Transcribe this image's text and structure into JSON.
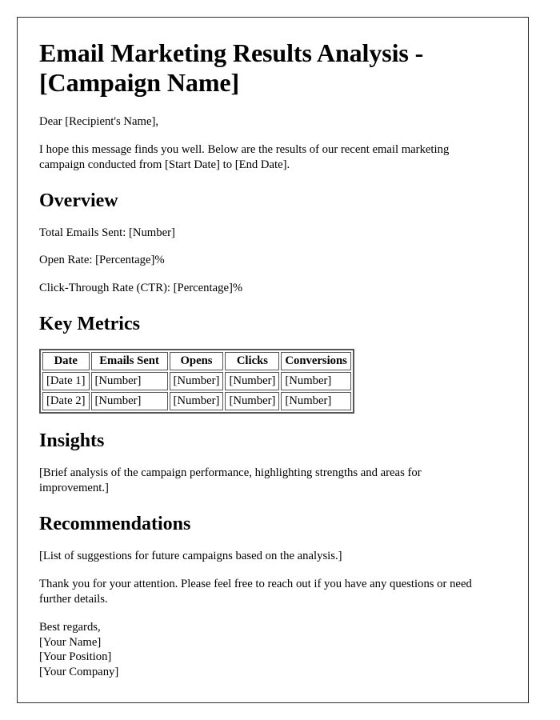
{
  "document": {
    "title": "Email Marketing Results Analysis - [Campaign Name]",
    "salutation": "Dear [Recipient's Name],",
    "intro": "I hope this message finds you well. Below are the results of our recent email marketing campaign conducted from [Start Date] to [End Date].",
    "sections": {
      "overview": {
        "heading": "Overview",
        "lines": [
          "Total Emails Sent: [Number]",
          "Open Rate: [Percentage]%",
          "Click-Through Rate (CTR): [Percentage]%"
        ]
      },
      "key_metrics": {
        "heading": "Key Metrics",
        "columns": [
          "Date",
          "Emails Sent",
          "Opens",
          "Clicks",
          "Conversions"
        ],
        "rows": [
          [
            "[Date 1]",
            "[Number]",
            "[Number]",
            "[Number]",
            "[Number]"
          ],
          [
            "[Date 2]",
            "[Number]",
            "[Number]",
            "[Number]",
            "[Number]"
          ]
        ]
      },
      "insights": {
        "heading": "Insights",
        "body": "[Brief analysis of the campaign performance, highlighting strengths and areas for improvement.]"
      },
      "recommendations": {
        "heading": "Recommendations",
        "body": "[List of suggestions for future campaigns based on the analysis.]"
      }
    },
    "closing": "Thank you for your attention. Please feel free to reach out if you have any questions or need further details.",
    "signature": {
      "valediction": "Best regards,",
      "name": "[Your Name]",
      "position": "[Your Position]",
      "company": "[Your Company]"
    }
  }
}
